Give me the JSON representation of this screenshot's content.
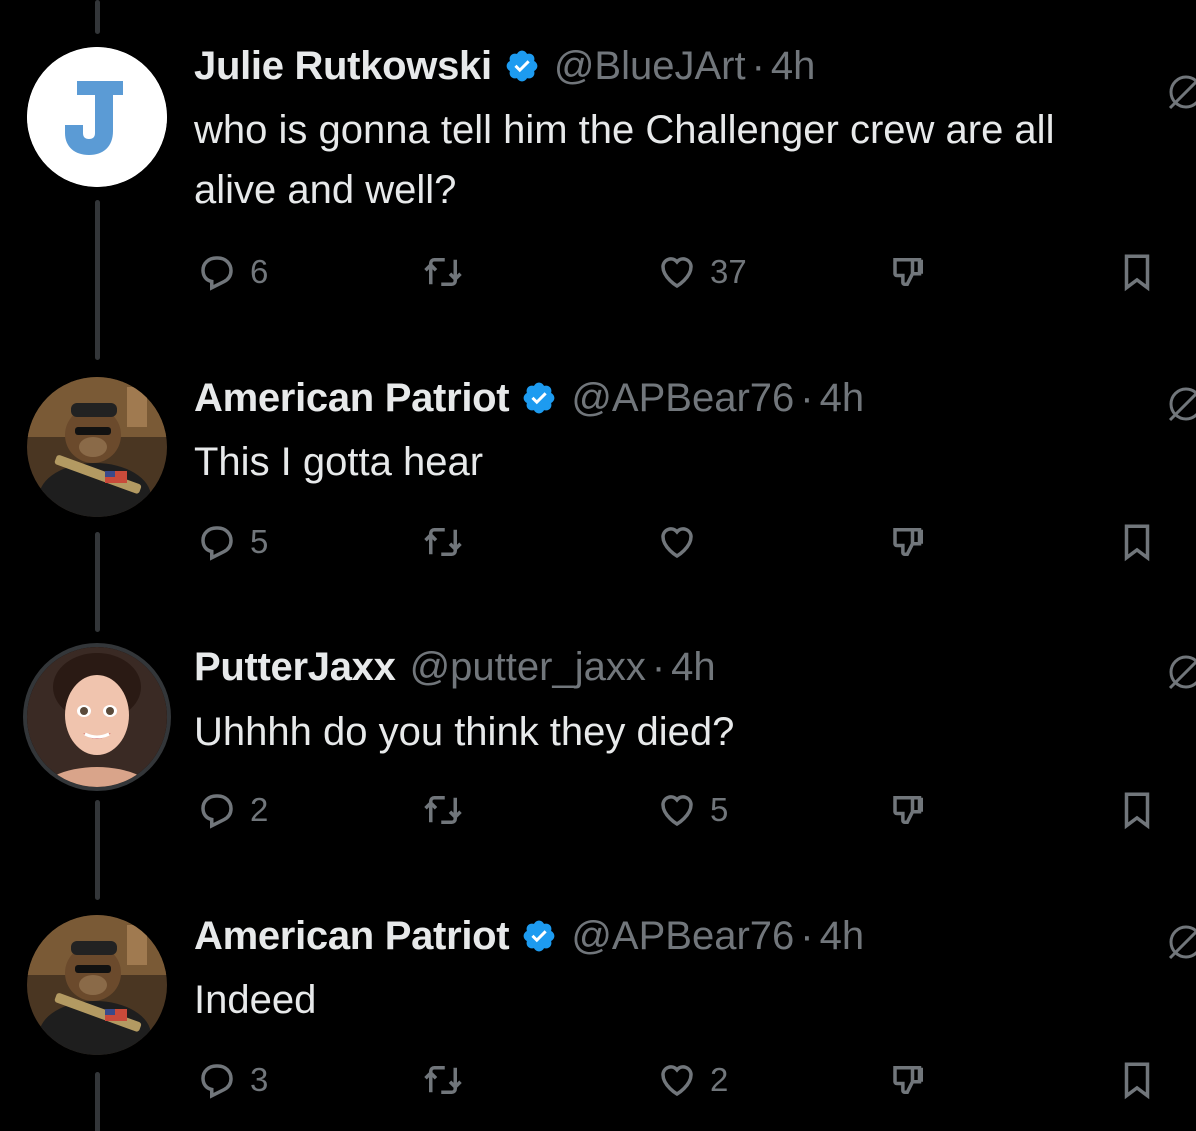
{
  "colors": {
    "background": "#000000",
    "text_primary": "#e7e9ea",
    "text_secondary": "#71767b",
    "verified_blue": "#1d9bf0",
    "thread_line": "#333639"
  },
  "tweets": [
    {
      "name": "Julie Rutkowski",
      "verified": true,
      "handle": "@BlueJArt",
      "dot": "·",
      "time": "4h",
      "text": "who is gonna tell him the Challenger crew are all\nalive and well?",
      "avatar": "letter-j-avatar",
      "replies": "6",
      "retweets": "",
      "likes": "37"
    },
    {
      "name": "American Patriot",
      "verified": true,
      "handle": "@APBear76",
      "dot": "·",
      "time": "4h",
      "text": "This I gotta hear",
      "avatar": "bear-soldier-avatar",
      "replies": "5",
      "retweets": "",
      "likes": ""
    },
    {
      "name": "PutterJaxx",
      "verified": false,
      "handle": "@putter_jaxx",
      "dot": "·",
      "time": "4h",
      "text": "Uhhhh do you think they died?",
      "avatar": "woman-portrait-avatar",
      "replies": "2",
      "retweets": "",
      "likes": "5"
    },
    {
      "name": "American Patriot",
      "verified": true,
      "handle": "@APBear76",
      "dot": "·",
      "time": "4h",
      "text": "Indeed",
      "avatar": "bear-soldier-avatar",
      "replies": "3",
      "retweets": "",
      "likes": "2"
    }
  ]
}
